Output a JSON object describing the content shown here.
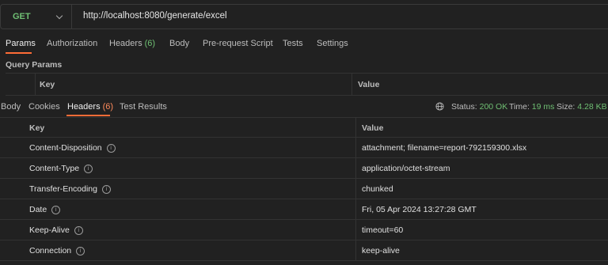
{
  "request": {
    "method": "GET",
    "url": "http://localhost:8080/generate/excel"
  },
  "request_tabs": [
    {
      "label": "Params",
      "count": ""
    },
    {
      "label": "Authorization",
      "count": ""
    },
    {
      "label": "Headers",
      "count": "(6)"
    },
    {
      "label": "Body",
      "count": ""
    },
    {
      "label": "Pre-request Script",
      "count": ""
    },
    {
      "label": "Tests",
      "count": ""
    },
    {
      "label": "Settings",
      "count": ""
    }
  ],
  "query_params": {
    "title": "Query Params",
    "key_header": "Key",
    "value_header": "Value"
  },
  "response_tabs": [
    {
      "label": "Body",
      "count": ""
    },
    {
      "label": "Cookies",
      "count": ""
    },
    {
      "label": "Headers",
      "count": "(6)"
    },
    {
      "label": "Test Results",
      "count": ""
    }
  ],
  "response_status": {
    "status_label": "Status:",
    "status_value": "200 OK",
    "time_label": "Time:",
    "time_value": "19 ms",
    "size_label": "Size:",
    "size_value": "4.28 KB"
  },
  "headers_table": {
    "key_header": "Key",
    "value_header": "Value",
    "rows": [
      {
        "key": "Content-Disposition",
        "value": "attachment; filename=report-792159300.xlsx"
      },
      {
        "key": "Content-Type",
        "value": "application/octet-stream"
      },
      {
        "key": "Transfer-Encoding",
        "value": "chunked"
      },
      {
        "key": "Date",
        "value": "Fri, 05 Apr 2024 13:27:28 GMT"
      },
      {
        "key": "Keep-Alive",
        "value": "timeout=60"
      },
      {
        "key": "Connection",
        "value": "keep-alive"
      }
    ]
  },
  "colors": {
    "accent": "#ff6c37",
    "success": "#6fbf73",
    "background": "#212121"
  }
}
